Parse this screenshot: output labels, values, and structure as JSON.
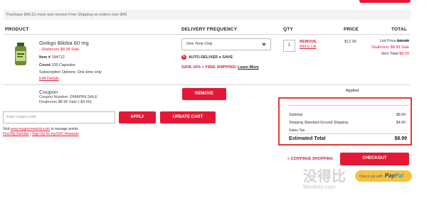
{
  "promo": {
    "text": "Purchase $40.01 more and receive Free Shipping on orders over $49"
  },
  "headers": {
    "product": "PRODUCT",
    "frequency": "DELIVERY FREQUENCY",
    "qty": "QTY",
    "price": "PRICE",
    "total": "TOTAL"
  },
  "item": {
    "name": "Ginkgo Biloba 60 mg",
    "sale": "- Dealmoon $8.99 Sale",
    "item_label": "Item #",
    "item_number": "194712",
    "count_label": "Count",
    "count_value": "100 Capsules",
    "subscription": "Subscription Options: One time only",
    "edit_details": "Edit Details",
    "frequency_value": "One Time Only",
    "autodeliver": "AUTO-DELIVER",
    "autodeliver_save": "SAVE",
    "save_text": "SAVE 10% + FREE SHIPPING!",
    "learn_more": "Learn More",
    "qty": "1",
    "remove": "REMOVE",
    "add_to_list": "Add to List",
    "price": "$12.99",
    "list_price_label": "List Price",
    "list_price": "$12.99",
    "dealmoon_label": "Dealmoon",
    "dealmoon_price": "$8.99 Sale",
    "item_total_label": "Item Total",
    "item_total": "$8.99"
  },
  "coupon": {
    "title": "Coupon",
    "number": "Coupon Number: DMAPRILSALE",
    "desc": "Dealmoon $8.99 Sale (-$4.00)",
    "remove_button": "REMOVE",
    "status": "Applied"
  },
  "coupon_form": {
    "placeholder": "Enter coupon code",
    "apply": "APPLY",
    "update": "UPDATE CART",
    "rewards_prefix": "Visit",
    "rewards_link": "www.mygncrewards.com",
    "rewards_suffix": "to manage points",
    "find_number": "Find My Number",
    "separator": "|",
    "signup": "Sign-Up for myGNC Rewards"
  },
  "summary": {
    "subtotal_label": "Subtotal",
    "subtotal": "$8.99",
    "shipping_label": "Shipping Standard Ground Shipping",
    "shipping": "$4.99",
    "tax_label": "Sales Tax",
    "tax": "-",
    "estimated_label": "Estimated Total",
    "estimated": "$8.99"
  },
  "actions": {
    "continue": "« CONTINUE SHOPPING",
    "checkout": "CHECKOUT",
    "paypal_prefix": "Check out with",
    "paypal_a": "Pay",
    "paypal_b": "Pal"
  },
  "watermark": {
    "main": "没得比",
    "sub": "Meidebi.com"
  },
  "colors": {
    "accent": "#e31837",
    "highlight_box": "#e53935",
    "paypal": "#f3c341"
  }
}
